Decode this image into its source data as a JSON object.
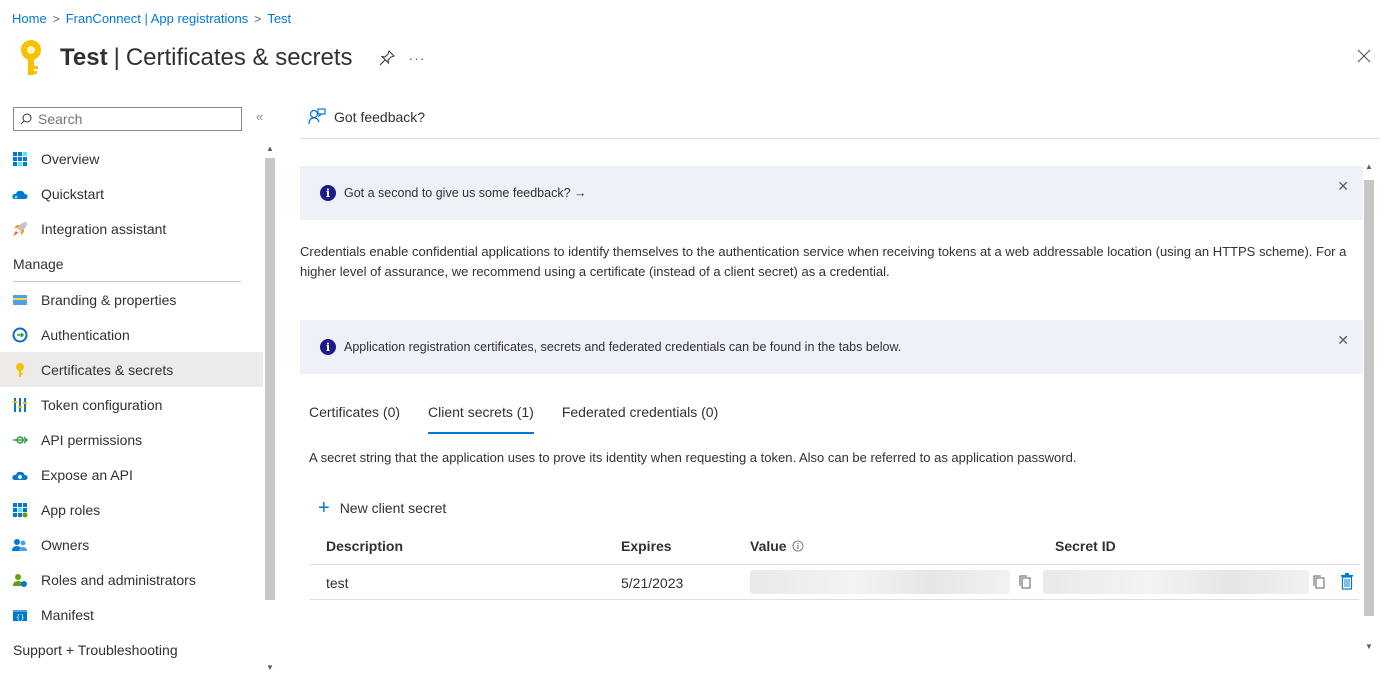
{
  "breadcrumb": [
    {
      "label": "Home"
    },
    {
      "label": "FranConnect | App registrations"
    },
    {
      "label": "Test"
    }
  ],
  "header": {
    "title": "Test",
    "separator": "|",
    "subtitle": "Certificates & secrets",
    "more": "···"
  },
  "sidebar": {
    "search_placeholder": "Search",
    "collapse": "«",
    "items": [
      {
        "label": "Overview",
        "icon": "overview-grid-icon"
      },
      {
        "label": "Quickstart",
        "icon": "cloud-icon"
      },
      {
        "label": "Integration assistant",
        "icon": "rocket-icon"
      }
    ],
    "manage_header": "Manage",
    "manage_items": [
      {
        "label": "Branding & properties",
        "icon": "branding-card-icon"
      },
      {
        "label": "Authentication",
        "icon": "auth-circle-icon"
      },
      {
        "label": "Certificates & secrets",
        "icon": "key-icon",
        "active": true
      },
      {
        "label": "Token configuration",
        "icon": "token-bars-icon"
      },
      {
        "label": "API permissions",
        "icon": "permission-arrow-icon"
      },
      {
        "label": "Expose an API",
        "icon": "cloud-api-icon"
      },
      {
        "label": "App roles",
        "icon": "app-roles-grid-icon"
      },
      {
        "label": "Owners",
        "icon": "owners-people-icon"
      },
      {
        "label": "Roles and administrators",
        "icon": "admin-person-icon"
      },
      {
        "label": "Manifest",
        "icon": "manifest-icon"
      }
    ],
    "support_header": "Support + Troubleshooting"
  },
  "main": {
    "feedback_label": "Got feedback?",
    "banner1": "Got a second to give us some feedback? →",
    "description": "Credentials enable confidential applications to identify themselves to the authentication service when receiving tokens at a web addressable location (using an HTTPS scheme). For a higher level of assurance, we recommend using a certificate (instead of a client secret) as a credential.",
    "banner2": "Application registration certificates, secrets and federated credentials can be found in the tabs below.",
    "tabs": [
      {
        "label": "Certificates (0)"
      },
      {
        "label": "Client secrets (1)",
        "active": true
      },
      {
        "label": "Federated credentials (0)"
      }
    ],
    "tab_description": "A secret string that the application uses to prove its identity when requesting a token. Also can be referred to as application password.",
    "new_secret_label": "New client secret",
    "table": {
      "columns": [
        "Description",
        "Expires",
        "Value",
        "Secret ID"
      ],
      "rows": [
        {
          "description": "test",
          "expires": "5/21/2023",
          "value": "",
          "secret_id": ""
        }
      ]
    }
  },
  "colors": {
    "accent": "#0078d4",
    "banner_bg": "#eff1f8",
    "key_gold": "#f8c100"
  }
}
